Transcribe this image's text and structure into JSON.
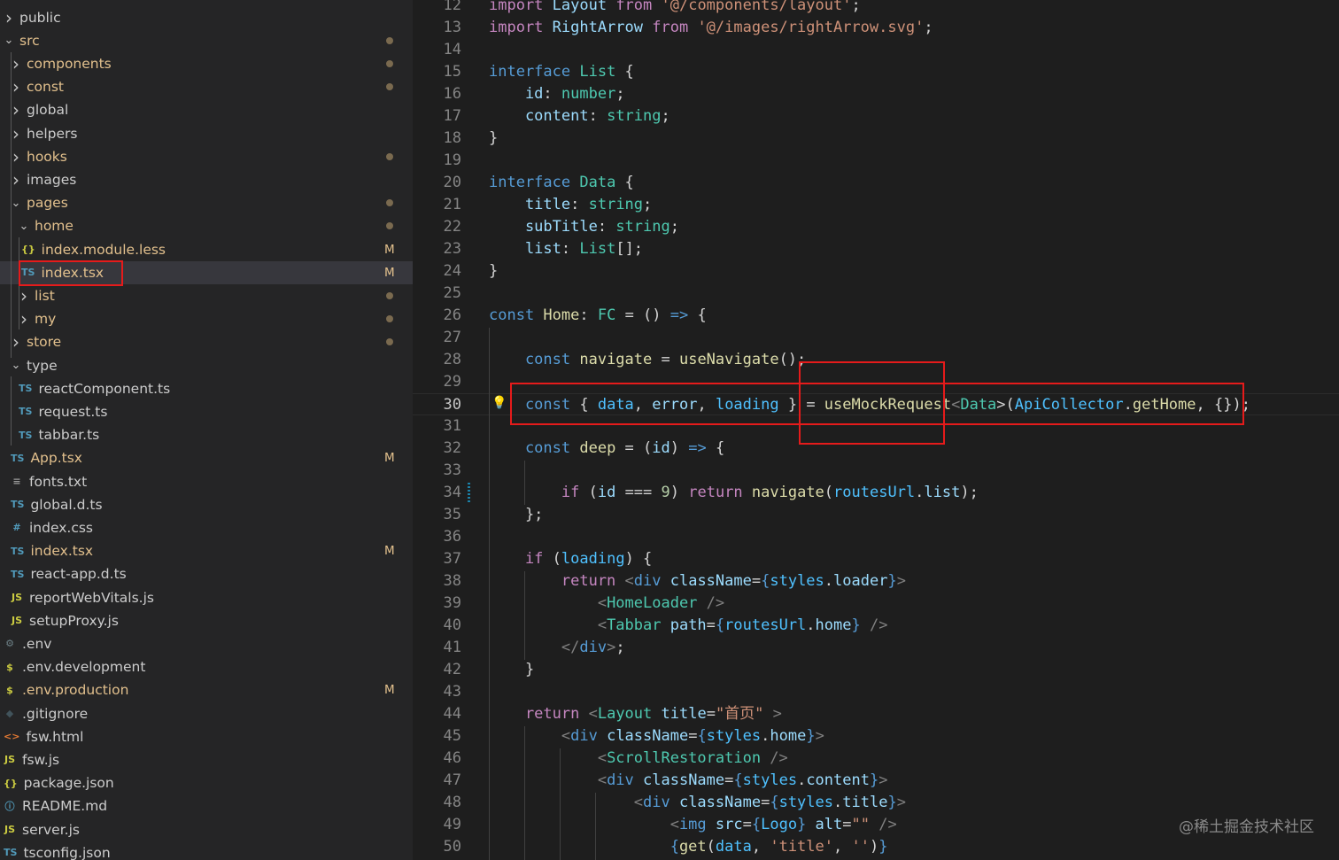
{
  "explorer": {
    "items": [
      {
        "name": "public",
        "icon": "chevron-right",
        "modified": false
      },
      {
        "name": "src",
        "icon": "chevron-down",
        "modified": true
      },
      {
        "name": "components",
        "icon": "chevron-right",
        "modified": true
      },
      {
        "name": "const",
        "icon": "chevron-right",
        "modified": true
      },
      {
        "name": "global",
        "icon": "chevron-right",
        "modified": false
      },
      {
        "name": "helpers",
        "icon": "chevron-right",
        "modified": false
      },
      {
        "name": "hooks",
        "icon": "chevron-right",
        "modified": true
      },
      {
        "name": "images",
        "icon": "chevron-right",
        "modified": false
      },
      {
        "name": "pages",
        "icon": "chevron-down",
        "modified": true
      },
      {
        "name": "home",
        "icon": "chevron-down",
        "modified": true
      },
      {
        "name": "index.module.less",
        "icon": "{}",
        "modified": true,
        "badge": "M"
      },
      {
        "name": "index.tsx",
        "icon": "TS",
        "modified": true,
        "badge": "M",
        "selected": true
      },
      {
        "name": "list",
        "icon": "chevron-right",
        "modified": true
      },
      {
        "name": "my",
        "icon": "chevron-right",
        "modified": true
      },
      {
        "name": "store",
        "icon": "chevron-right",
        "modified": true
      },
      {
        "name": "type",
        "icon": "chevron-down",
        "modified": false
      },
      {
        "name": "reactComponent.ts",
        "icon": "TS",
        "modified": false
      },
      {
        "name": "request.ts",
        "icon": "TS",
        "modified": false
      },
      {
        "name": "tabbar.ts",
        "icon": "TS",
        "modified": false
      },
      {
        "name": "App.tsx",
        "icon": "TS",
        "modified": true,
        "badge": "M"
      },
      {
        "name": "fonts.txt",
        "icon": "≡",
        "modified": false
      },
      {
        "name": "global.d.ts",
        "icon": "TS",
        "modified": false
      },
      {
        "name": "index.css",
        "icon": "#",
        "modified": false
      },
      {
        "name": "index.tsx",
        "icon": "TS",
        "modified": true,
        "badge": "M"
      },
      {
        "name": "react-app.d.ts",
        "icon": "TS",
        "modified": false
      },
      {
        "name": "reportWebVitals.js",
        "icon": "JS",
        "modified": false
      },
      {
        "name": "setupProxy.js",
        "icon": "JS",
        "modified": false
      },
      {
        "name": ".env",
        "icon": "⚙",
        "modified": false
      },
      {
        "name": ".env.development",
        "icon": "$",
        "modified": false
      },
      {
        "name": ".env.production",
        "icon": "$",
        "modified": true,
        "badge": "M"
      },
      {
        "name": ".gitignore",
        "icon": "◆",
        "modified": false
      },
      {
        "name": "fsw.html",
        "icon": "<>",
        "modified": false
      },
      {
        "name": "fsw.js",
        "icon": "JS",
        "modified": false
      },
      {
        "name": "package.json",
        "icon": "{}",
        "modified": false
      },
      {
        "name": "README.md",
        "icon": "ⓘ",
        "modified": false
      },
      {
        "name": "server.js",
        "icon": "JS",
        "modified": false
      },
      {
        "name": "tsconfig.json",
        "icon": "TS",
        "modified": false
      }
    ]
  },
  "editor": {
    "lines": [
      {
        "n": "12",
        "tokens": [
          [
            "kc",
            "import "
          ],
          [
            "vr",
            "Layout"
          ],
          [
            "kc",
            " from "
          ],
          [
            "st",
            "'@/components/layout'"
          ],
          [
            "pn",
            ";"
          ]
        ]
      },
      {
        "n": "13",
        "tokens": [
          [
            "kc",
            "import "
          ],
          [
            "vr",
            "RightArrow"
          ],
          [
            "kc",
            " from "
          ],
          [
            "st",
            "'@/images/rightArrow.svg'"
          ],
          [
            "pn",
            ";"
          ]
        ]
      },
      {
        "n": "14",
        "tokens": []
      },
      {
        "n": "15",
        "tokens": [
          [
            "kw",
            "interface "
          ],
          [
            "ty",
            "List"
          ],
          [
            "pn",
            " {"
          ]
        ]
      },
      {
        "n": "16",
        "tokens": [
          [
            "vr",
            "    id"
          ],
          [
            "pn",
            ": "
          ],
          [
            "ty",
            "number"
          ],
          [
            "pn",
            ";"
          ]
        ]
      },
      {
        "n": "17",
        "tokens": [
          [
            "vr",
            "    content"
          ],
          [
            "pn",
            ": "
          ],
          [
            "ty",
            "string"
          ],
          [
            "pn",
            ";"
          ]
        ]
      },
      {
        "n": "18",
        "tokens": [
          [
            "pn",
            "}"
          ]
        ]
      },
      {
        "n": "19",
        "tokens": []
      },
      {
        "n": "20",
        "tokens": [
          [
            "kw",
            "interface "
          ],
          [
            "ty",
            "Data"
          ],
          [
            "pn",
            " {"
          ]
        ]
      },
      {
        "n": "21",
        "tokens": [
          [
            "vr",
            "    title"
          ],
          [
            "pn",
            ": "
          ],
          [
            "ty",
            "string"
          ],
          [
            "pn",
            ";"
          ]
        ]
      },
      {
        "n": "22",
        "tokens": [
          [
            "vr",
            "    subTitle"
          ],
          [
            "pn",
            ": "
          ],
          [
            "ty",
            "string"
          ],
          [
            "pn",
            ";"
          ]
        ]
      },
      {
        "n": "23",
        "tokens": [
          [
            "vr",
            "    list"
          ],
          [
            "pn",
            ": "
          ],
          [
            "ty",
            "List"
          ],
          [
            "pn",
            "[];"
          ]
        ]
      },
      {
        "n": "24",
        "tokens": [
          [
            "pn",
            "}"
          ]
        ]
      },
      {
        "n": "25",
        "tokens": []
      },
      {
        "n": "26",
        "tokens": [
          [
            "kw",
            "const "
          ],
          [
            "fn",
            "Home"
          ],
          [
            "pn",
            ": "
          ],
          [
            "ty",
            "FC"
          ],
          [
            "pn",
            " = () "
          ],
          [
            "kw",
            "=>"
          ],
          [
            "pn",
            " {"
          ]
        ]
      },
      {
        "n": "27",
        "tokens": []
      },
      {
        "n": "28",
        "tokens": [
          [
            "kw",
            "    const "
          ],
          [
            "fn",
            "navigate"
          ],
          [
            "pn",
            " = "
          ],
          [
            "fn",
            "useNavigate"
          ],
          [
            "pn",
            "();"
          ]
        ]
      },
      {
        "n": "29",
        "tokens": []
      },
      {
        "n": "30",
        "tokens": [
          [
            "kw",
            "    const "
          ],
          [
            "pn",
            "{ "
          ],
          [
            "cn",
            "data"
          ],
          [
            "pn",
            ", "
          ],
          [
            "vr",
            "error"
          ],
          [
            "pn",
            ", "
          ],
          [
            "cn",
            "loading"
          ],
          [
            "pn",
            " } = "
          ],
          [
            "fn",
            "useMockRequest"
          ],
          [
            "tg",
            "<"
          ],
          [
            "ty",
            "Data"
          ],
          [
            "pn",
            ">("
          ],
          [
            "cn",
            "ApiCollector"
          ],
          [
            "pn",
            "."
          ],
          [
            "fn",
            "getHome"
          ],
          [
            "pn",
            ", {});"
          ]
        ],
        "active": true
      },
      {
        "n": "31",
        "tokens": []
      },
      {
        "n": "32",
        "tokens": [
          [
            "kw",
            "    const "
          ],
          [
            "fn",
            "deep"
          ],
          [
            "pn",
            " = ("
          ],
          [
            "vr",
            "id"
          ],
          [
            "pn",
            ") "
          ],
          [
            "kw",
            "=>"
          ],
          [
            "pn",
            " {"
          ]
        ]
      },
      {
        "n": "33",
        "tokens": []
      },
      {
        "n": "34",
        "tokens": [
          [
            "kc",
            "        if "
          ],
          [
            "pn",
            "("
          ],
          [
            "vr",
            "id"
          ],
          [
            "pn",
            " === "
          ],
          [
            "nm",
            "9"
          ],
          [
            "pn",
            ") "
          ],
          [
            "kc",
            "return "
          ],
          [
            "fn",
            "navigate"
          ],
          [
            "pn",
            "("
          ],
          [
            "cn",
            "routesUrl"
          ],
          [
            "pn",
            "."
          ],
          [
            "vr",
            "list"
          ],
          [
            "pn",
            ");"
          ]
        ]
      },
      {
        "n": "35",
        "tokens": [
          [
            "pn",
            "    };"
          ]
        ]
      },
      {
        "n": "36",
        "tokens": []
      },
      {
        "n": "37",
        "tokens": [
          [
            "kc",
            "    if "
          ],
          [
            "pn",
            "("
          ],
          [
            "cn",
            "loading"
          ],
          [
            "pn",
            ") {"
          ]
        ]
      },
      {
        "n": "38",
        "tokens": [
          [
            "kc",
            "        return "
          ],
          [
            "tg",
            "<"
          ],
          [
            "kw",
            "div "
          ],
          [
            "vr",
            "className"
          ],
          [
            "pn",
            "="
          ],
          [
            "kw",
            "{"
          ],
          [
            "cn",
            "styles"
          ],
          [
            "pn",
            "."
          ],
          [
            "vr",
            "loader"
          ],
          [
            "kw",
            "}"
          ],
          [
            "tg",
            ">"
          ]
        ]
      },
      {
        "n": "39",
        "tokens": [
          [
            "tg",
            "            <"
          ],
          [
            "ty",
            "HomeLoader"
          ],
          [
            "tg",
            " />"
          ]
        ]
      },
      {
        "n": "40",
        "tokens": [
          [
            "tg",
            "            <"
          ],
          [
            "ty",
            "Tabbar "
          ],
          [
            "vr",
            "path"
          ],
          [
            "pn",
            "="
          ],
          [
            "kw",
            "{"
          ],
          [
            "cn",
            "routesUrl"
          ],
          [
            "pn",
            "."
          ],
          [
            "vr",
            "home"
          ],
          [
            "kw",
            "}"
          ],
          [
            "tg",
            " />"
          ]
        ]
      },
      {
        "n": "41",
        "tokens": [
          [
            "tg",
            "        </"
          ],
          [
            "kw",
            "div"
          ],
          [
            "tg",
            ">"
          ],
          [
            "pn",
            ";"
          ]
        ]
      },
      {
        "n": "42",
        "tokens": [
          [
            "pn",
            "    }"
          ]
        ]
      },
      {
        "n": "43",
        "tokens": []
      },
      {
        "n": "44",
        "tokens": [
          [
            "kc",
            "    return "
          ],
          [
            "tg",
            "<"
          ],
          [
            "ty",
            "Layout "
          ],
          [
            "vr",
            "title"
          ],
          [
            "pn",
            "="
          ],
          [
            "st",
            "\"首页\""
          ],
          [
            "tg",
            " >"
          ]
        ]
      },
      {
        "n": "45",
        "tokens": [
          [
            "tg",
            "        <"
          ],
          [
            "kw",
            "div "
          ],
          [
            "vr",
            "className"
          ],
          [
            "pn",
            "="
          ],
          [
            "kw",
            "{"
          ],
          [
            "cn",
            "styles"
          ],
          [
            "pn",
            "."
          ],
          [
            "vr",
            "home"
          ],
          [
            "kw",
            "}"
          ],
          [
            "tg",
            ">"
          ]
        ]
      },
      {
        "n": "46",
        "tokens": [
          [
            "tg",
            "            <"
          ],
          [
            "ty",
            "ScrollRestoration"
          ],
          [
            "tg",
            " />"
          ]
        ]
      },
      {
        "n": "47",
        "tokens": [
          [
            "tg",
            "            <"
          ],
          [
            "kw",
            "div "
          ],
          [
            "vr",
            "className"
          ],
          [
            "pn",
            "="
          ],
          [
            "kw",
            "{"
          ],
          [
            "cn",
            "styles"
          ],
          [
            "pn",
            "."
          ],
          [
            "vr",
            "content"
          ],
          [
            "kw",
            "}"
          ],
          [
            "tg",
            ">"
          ]
        ]
      },
      {
        "n": "48",
        "tokens": [
          [
            "tg",
            "                <"
          ],
          [
            "kw",
            "div "
          ],
          [
            "vr",
            "className"
          ],
          [
            "pn",
            "="
          ],
          [
            "kw",
            "{"
          ],
          [
            "cn",
            "styles"
          ],
          [
            "pn",
            "."
          ],
          [
            "vr",
            "title"
          ],
          [
            "kw",
            "}"
          ],
          [
            "tg",
            ">"
          ]
        ]
      },
      {
        "n": "49",
        "tokens": [
          [
            "tg",
            "                    <"
          ],
          [
            "kw",
            "img "
          ],
          [
            "vr",
            "src"
          ],
          [
            "pn",
            "="
          ],
          [
            "kw",
            "{"
          ],
          [
            "cn",
            "Logo"
          ],
          [
            "kw",
            "}"
          ],
          [
            "vr",
            " alt"
          ],
          [
            "pn",
            "="
          ],
          [
            "st",
            "\"\""
          ],
          [
            "tg",
            " />"
          ]
        ]
      },
      {
        "n": "50",
        "tokens": [
          [
            "kw",
            "                    {"
          ],
          [
            "fn",
            "get"
          ],
          [
            "pn",
            "("
          ],
          [
            "cn",
            "data"
          ],
          [
            "pn",
            ", "
          ],
          [
            "st",
            "'title'"
          ],
          [
            "pn",
            ", "
          ],
          [
            "st",
            "''"
          ],
          [
            "pn",
            ")"
          ],
          [
            "kw",
            "}"
          ]
        ]
      }
    ]
  },
  "watermark": "@稀土掘金技术社区",
  "colors": {
    "annotation": "#e51b1b",
    "modified": "#e2c08d",
    "ts_icon": "#3178c6",
    "js_icon": "#cbcb41"
  }
}
